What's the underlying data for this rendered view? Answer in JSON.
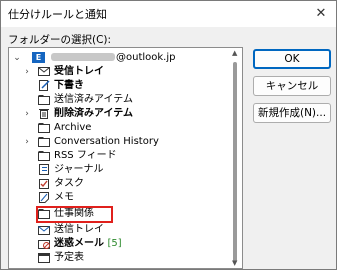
{
  "window": {
    "title": "仕分けルールと通知",
    "close_glyph": "✕"
  },
  "folder_label": "フォルダーの選択(C):",
  "tree": {
    "account": "@outlook.jp",
    "items": [
      {
        "label": "受信トレイ",
        "bold": true,
        "expander": "›",
        "icon": "inbox-icon"
      },
      {
        "label": "下書き",
        "bold": true,
        "expander": "",
        "icon": "drafts-icon"
      },
      {
        "label": "送信済みアイテム",
        "bold": false,
        "expander": "",
        "icon": "sent-folder-icon"
      },
      {
        "label": "削除済みアイテム",
        "bold": true,
        "expander": "›",
        "icon": "trash-icon"
      },
      {
        "label": "Archive",
        "bold": false,
        "expander": "",
        "icon": "folder-icon"
      },
      {
        "label": "Conversation History",
        "bold": false,
        "expander": "›",
        "icon": "folder-icon"
      },
      {
        "label": "RSS フィード",
        "bold": false,
        "expander": "",
        "icon": "rss-folder-icon"
      },
      {
        "label": "ジャーナル",
        "bold": false,
        "expander": "",
        "icon": "journal-icon"
      },
      {
        "label": "タスク",
        "bold": false,
        "expander": "",
        "icon": "task-icon"
      },
      {
        "label": "メモ",
        "bold": false,
        "expander": "",
        "icon": "note-icon"
      },
      {
        "label": "仕事関係",
        "bold": false,
        "expander": "",
        "icon": "folder-icon"
      },
      {
        "label": "送信トレイ",
        "bold": false,
        "expander": "",
        "icon": "outbox-icon"
      },
      {
        "label": "迷惑メール",
        "bold": true,
        "expander": "",
        "icon": "junk-icon",
        "count": "[5]"
      },
      {
        "label": "予定表",
        "bold": false,
        "expander": "",
        "icon": "calendar-icon"
      }
    ]
  },
  "buttons": {
    "ok": "OK",
    "cancel": "キャンセル",
    "new": "新規作成(N)..."
  }
}
